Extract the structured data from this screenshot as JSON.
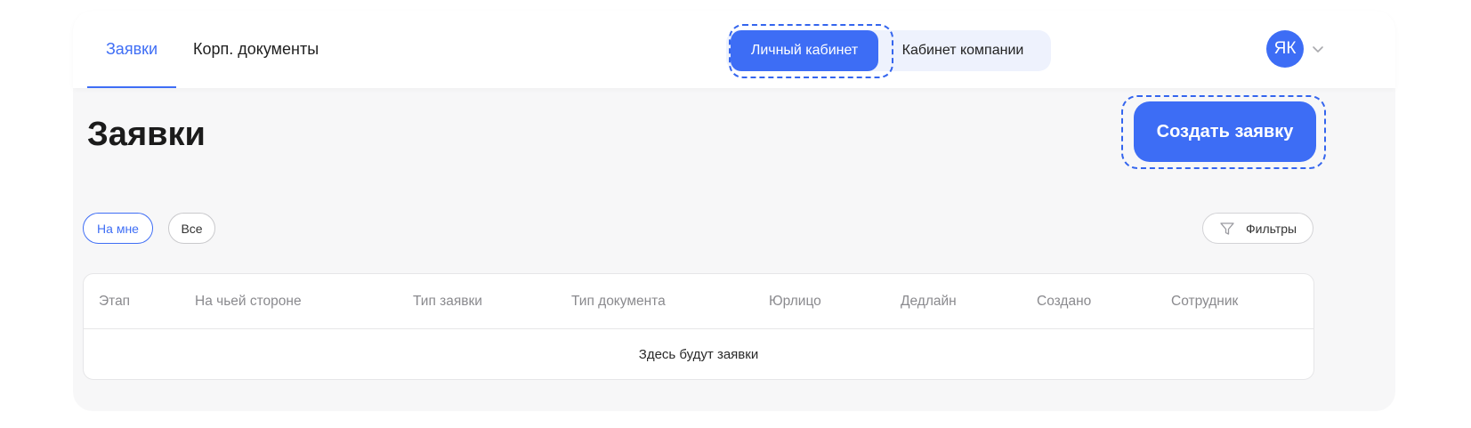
{
  "header": {
    "tabs": [
      {
        "label": "Заявки",
        "active": true
      },
      {
        "label": "Корп. документы",
        "active": false
      }
    ],
    "cabinet_switcher": {
      "personal": "Личный кабинет",
      "company": "Кабинет компании",
      "selected": "personal"
    },
    "user": {
      "initials": "ЯК"
    }
  },
  "page": {
    "title": "Заявки",
    "create_button": "Создать заявку"
  },
  "filters": {
    "chips": [
      {
        "label": "На мне",
        "selected": true
      },
      {
        "label": "Все",
        "selected": false
      }
    ],
    "filters_button": "Фильтры"
  },
  "table": {
    "columns": [
      "Этап",
      "На чьей стороне",
      "Тип заявки",
      "Тип документа",
      "Юрлицо",
      "Дедлайн",
      "Создано",
      "Сотрудник"
    ],
    "empty_text": "Здесь будут заявки"
  },
  "colors": {
    "accent": "#3d6df5",
    "switcher_bg": "#eef2fd",
    "page_bg": "#f7f7f8"
  },
  "icons": [
    "chevron-down-icon",
    "filter-funnel-icon"
  ]
}
